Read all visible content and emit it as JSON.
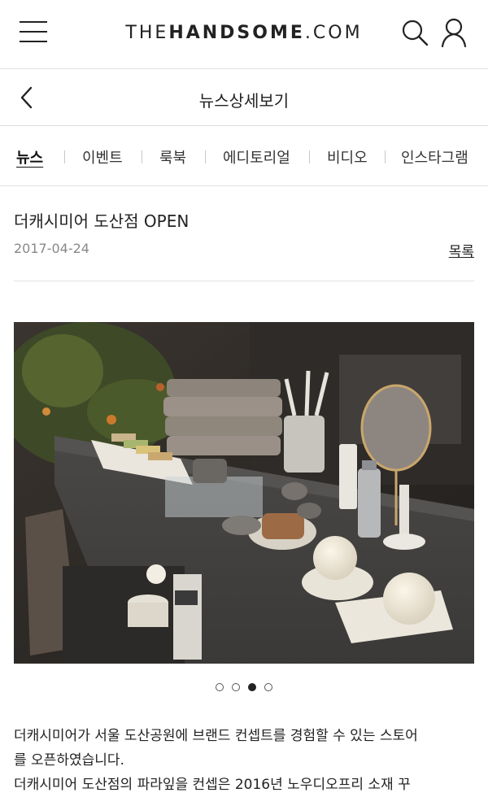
{
  "header": {
    "logo_prefix": "THE",
    "logo_bold": "HANDSOME",
    "logo_suffix": ".COM"
  },
  "subheader": {
    "title": "뉴스상세보기"
  },
  "tabs": [
    {
      "label": "뉴스",
      "active": true
    },
    {
      "label": "이벤트",
      "active": false
    },
    {
      "label": "룩북",
      "active": false
    },
    {
      "label": "에디토리얼",
      "active": false
    },
    {
      "label": "비디오",
      "active": false
    },
    {
      "label": "인스타그램",
      "active": false
    }
  ],
  "article": {
    "title": "더캐시미어 도산점 OPEN",
    "date": "2017-04-24",
    "list_label": "목록",
    "carousel": {
      "total": 4,
      "active_index": 3
    },
    "body_line1": "더캐시미어가 서울 도산공원에 브랜드 컨셉트를 경험할 수 있는 스토어",
    "body_line2": "를 오픈하였습니다.",
    "body_line3": "더캐시미어 도산점의 파라잎을 컨셉은 2016년 노우디오프리 소재 꾸"
  },
  "colors": {
    "text": "#222222",
    "muted": "#888888",
    "divider": "#e2e2e2"
  }
}
